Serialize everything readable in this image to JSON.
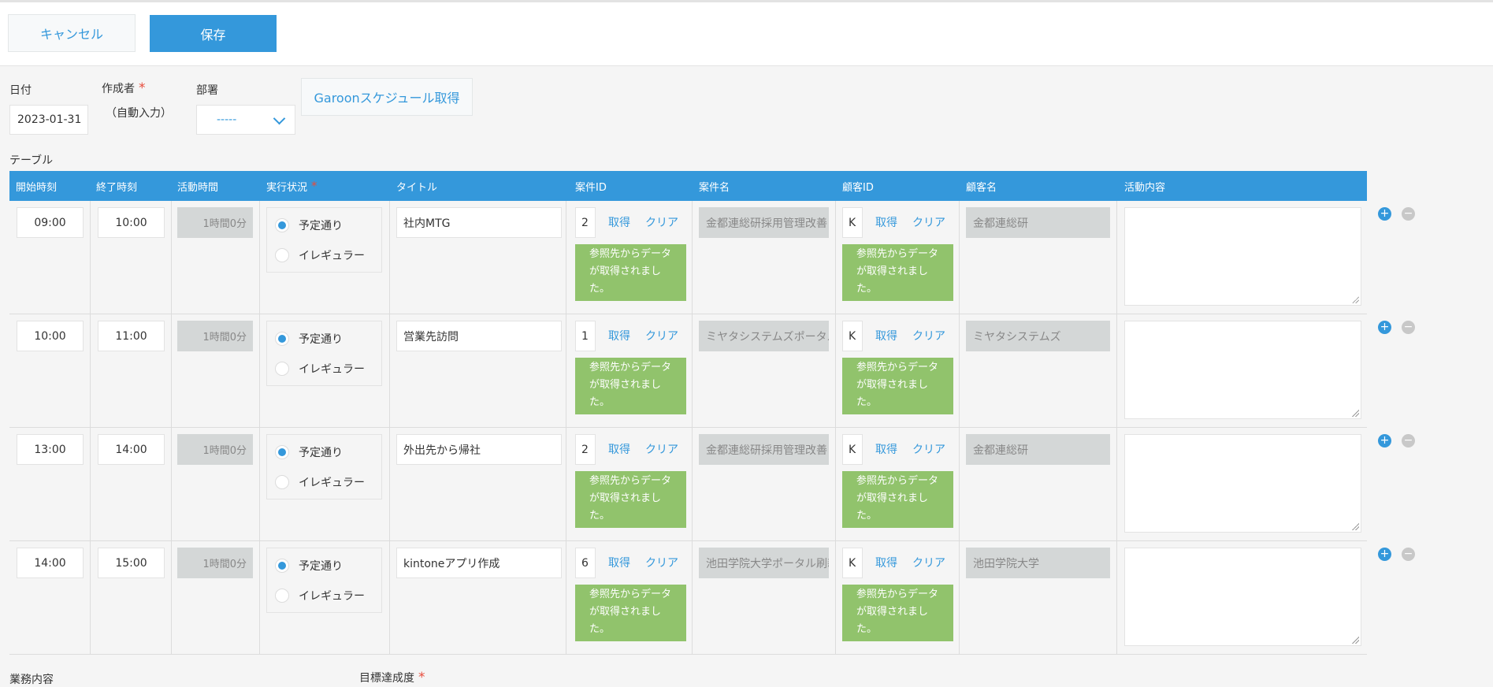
{
  "toolbar": {
    "cancel_label": "キャンセル",
    "save_label": "保存"
  },
  "form": {
    "date_label": "日付",
    "date_value": "2023-01-31",
    "creator_label": "作成者",
    "creator_value": "（自動入力）",
    "dept_label": "部署",
    "dept_value": "-----",
    "garoon_button": "Garoonスケジュール取得",
    "table_label": "テーブル",
    "required_mark": "*"
  },
  "table": {
    "columns": {
      "start": "開始時刻",
      "end": "終了時刻",
      "duration": "活動時間",
      "status": "実行状況",
      "title": "タイトル",
      "case_id": "案件ID",
      "case_name": "案件名",
      "customer_id": "顧客ID",
      "customer_name": "顧客名",
      "activity": "活動内容"
    },
    "status_options": [
      "予定通り",
      "イレギュラー"
    ],
    "fetch_label": "取得",
    "clear_label": "クリア",
    "notice_text": "参照先からデータが取得されました。",
    "rows": [
      {
        "start": "09:00",
        "end": "10:00",
        "duration": "1時間0分",
        "title": "社内MTG",
        "case_id": "2",
        "case_name": "金都連総研採用管理改善",
        "customer_id": "K",
        "customer_name": "金都連総研"
      },
      {
        "start": "10:00",
        "end": "11:00",
        "duration": "1時間0分",
        "title": "営業先訪問",
        "case_id": "1",
        "case_name": "ミヤタシステムズポータル",
        "customer_id": "K",
        "customer_name": "ミヤタシステムズ"
      },
      {
        "start": "13:00",
        "end": "14:00",
        "duration": "1時間0分",
        "title": "外出先から帰社",
        "case_id": "2",
        "case_name": "金都連総研採用管理改善",
        "customer_id": "K",
        "customer_name": "金都連総研"
      },
      {
        "start": "14:00",
        "end": "15:00",
        "duration": "1時間0分",
        "title": "kintoneアプリ作成",
        "case_id": "6",
        "case_name": "池田学院大学ポータル刷新",
        "customer_id": "K",
        "customer_name": "池田学院大学"
      }
    ]
  },
  "bottom": {
    "work_label": "業務内容",
    "goal_label": "目標達成度"
  },
  "colors": {
    "accent": "#3498db",
    "success": "#91c36c",
    "required": "#e74c3c"
  }
}
